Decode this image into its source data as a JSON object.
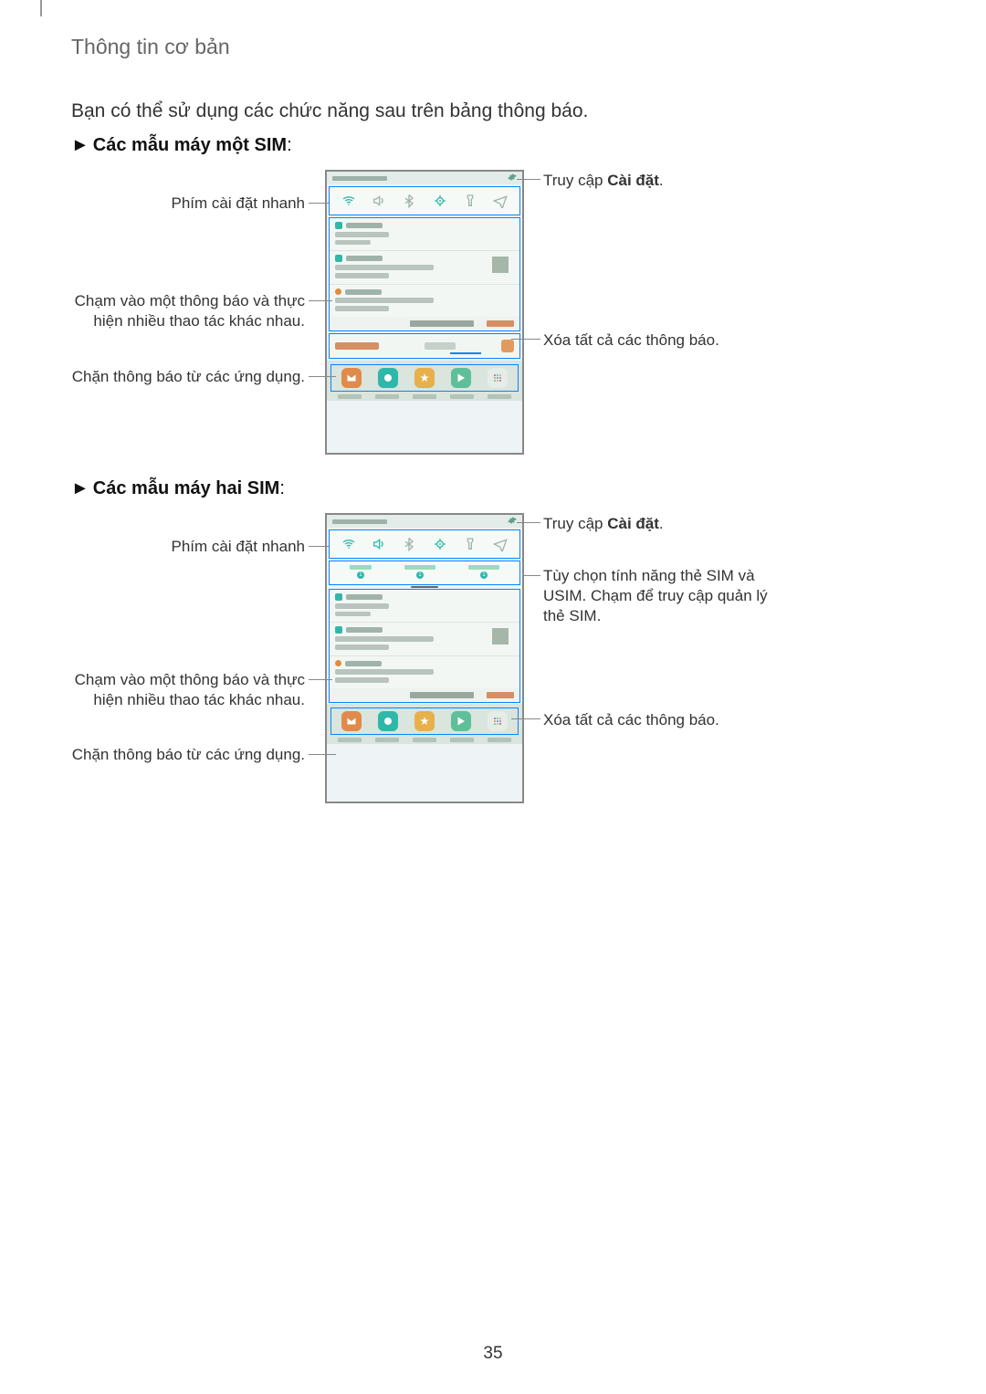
{
  "header": {
    "section_title": "Thông tin cơ bản"
  },
  "intro_text": "Bạn có thể sử dụng các chức năng sau trên bảng thông báo.",
  "subheadings": {
    "single_sim_prefix": "►",
    "single_sim_text": "Các mẫu máy một SIM",
    "single_sim_suffix": ":",
    "dual_sim_prefix": "►",
    "dual_sim_text": "Các mẫu máy hai SIM",
    "dual_sim_suffix": ":"
  },
  "callouts": {
    "quick_settings_keys": "Phím cài đặt nhanh",
    "tap_notification": "Chạm vào một thông báo và thực hiện nhiều thao tác khác nhau.",
    "block_notifications": "Chặn thông báo từ các ứng dụng.",
    "access_settings_pre": "Truy cập ",
    "access_settings_bold": "Cài đặt",
    "access_settings_post": ".",
    "clear_all": "Xóa tất cả các thông báo.",
    "sim_options": "Tùy chọn tính năng thẻ SIM và USIM. Chạm để truy cập quản lý thẻ SIM."
  },
  "page_number": "35"
}
